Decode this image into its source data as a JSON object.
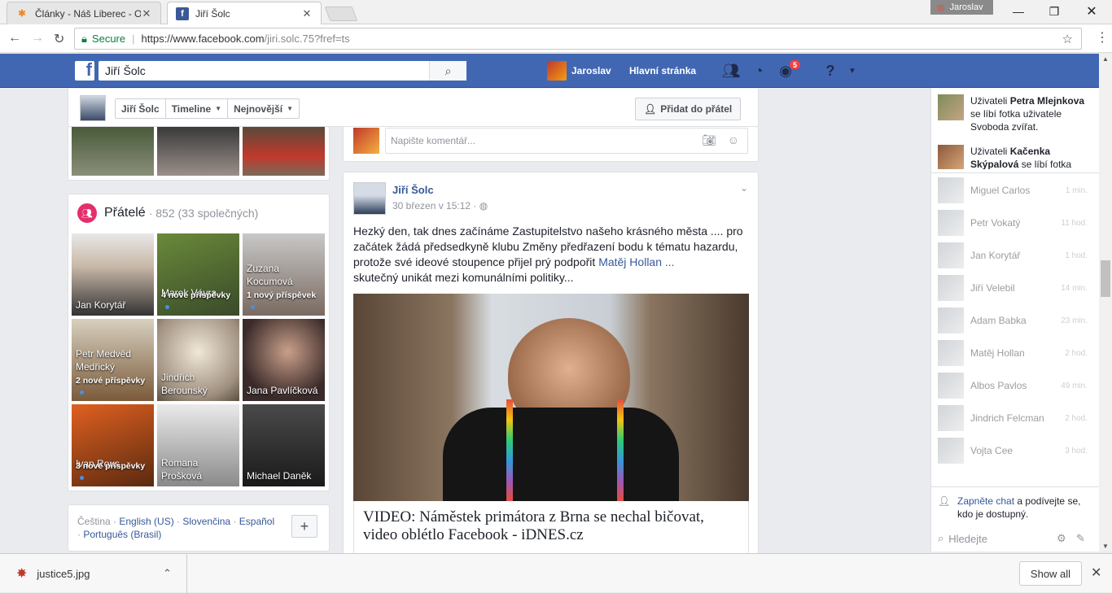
{
  "browser": {
    "tabs": [
      {
        "title": "Články - Náš Liberec - Ol",
        "icon": "joomla-icon"
      },
      {
        "title": "Jiří Šolc",
        "icon": "facebook-icon"
      }
    ],
    "profile_name": "Jaroslav",
    "secure_label": "Secure",
    "url_main": "https://www.facebook.com",
    "url_path": "/jiri.solc.75?fref=ts"
  },
  "fb": {
    "search_value": "Jiří Šolc",
    "user_name": "Jaroslav",
    "home_label": "Hlavní stránka",
    "notif_count": "5"
  },
  "profile_bar": {
    "crumbs": [
      "Jiří Šolc",
      "Timeline",
      "Nejnovější"
    ],
    "add_friend": "Přidat do přátel"
  },
  "friends": {
    "title": "Přátelé",
    "count": "· 852 (33 společných)",
    "tiles": [
      {
        "name": "Jan Korytář",
        "posts": ""
      },
      {
        "name": "Marek Vávra",
        "posts": "4 nové příspěvky"
      },
      {
        "name": "Zuzana Kocumová",
        "posts": "1 nový příspěvek"
      },
      {
        "name": "Petr Medvěd Medřický",
        "posts": "2 nové příspěvky"
      },
      {
        "name": "Jindřich Berounský",
        "posts": ""
      },
      {
        "name": "Jana Pavlíčková",
        "posts": ""
      },
      {
        "name": "Ivan Rous",
        "posts": "3 nové příspěvky"
      },
      {
        "name": "Romana Prošková",
        "posts": ""
      },
      {
        "name": "Michael Daněk",
        "posts": ""
      }
    ]
  },
  "languages": {
    "current": "Čeština",
    "links": [
      "English (US)",
      "Slovenčina",
      "Español",
      "Português (Brasil)"
    ]
  },
  "comment_placeholder": "Napište komentář...",
  "post": {
    "author": "Jiří Šolc",
    "date": "30 březen v 15:12",
    "text_1": "Hezký den, tak dnes začínáme Zastupitelstvo našeho krásného města .... pro začátek žádá předsedkyně klubu Změny předřazení bodu k tématu hazardu, protože své ideové stoupence přijel prý podpořit ",
    "text_link": "Matěj Hollan ...",
    "text_2": "skutečný unikát mezi komunálními politiky...",
    "link_title": "VIDEO: Náměstek primátora z Brna se nechal bičovat, video oblétlo Facebook - iDNES.cz"
  },
  "ticker": [
    {
      "pre": "Uživateli ",
      "name": "Petra Mlejnkova",
      "post": " se líbí fotka uživatele Svoboda zvířat."
    },
    {
      "pre": "Uživateli ",
      "name": "Kačenka Skýpalová",
      "post": " se líbí fotka"
    }
  ],
  "chat": [
    {
      "name": "Miguel Carlos",
      "time": "1 min."
    },
    {
      "name": "Petr Vokatý",
      "time": "11 hod."
    },
    {
      "name": "Jan Korytář",
      "time": "1 hod."
    },
    {
      "name": "Jiří Velebil",
      "time": "14 min."
    },
    {
      "name": "Adam Babka",
      "time": "23 min."
    },
    {
      "name": "Matěj Hollan",
      "time": "2 hod."
    },
    {
      "name": "Albos Pavlos",
      "time": "49 min."
    },
    {
      "name": "Jindrich Felcman",
      "time": "2 hod."
    },
    {
      "name": "Vojta Cee",
      "time": "3 hod."
    }
  ],
  "chat_footer": {
    "link": "Zapněte chat",
    "rest": " a podívejte se, kdo je dostupný.",
    "search": "Hledejte"
  },
  "download": {
    "file": "justice5.jpg",
    "show_all": "Show all"
  }
}
